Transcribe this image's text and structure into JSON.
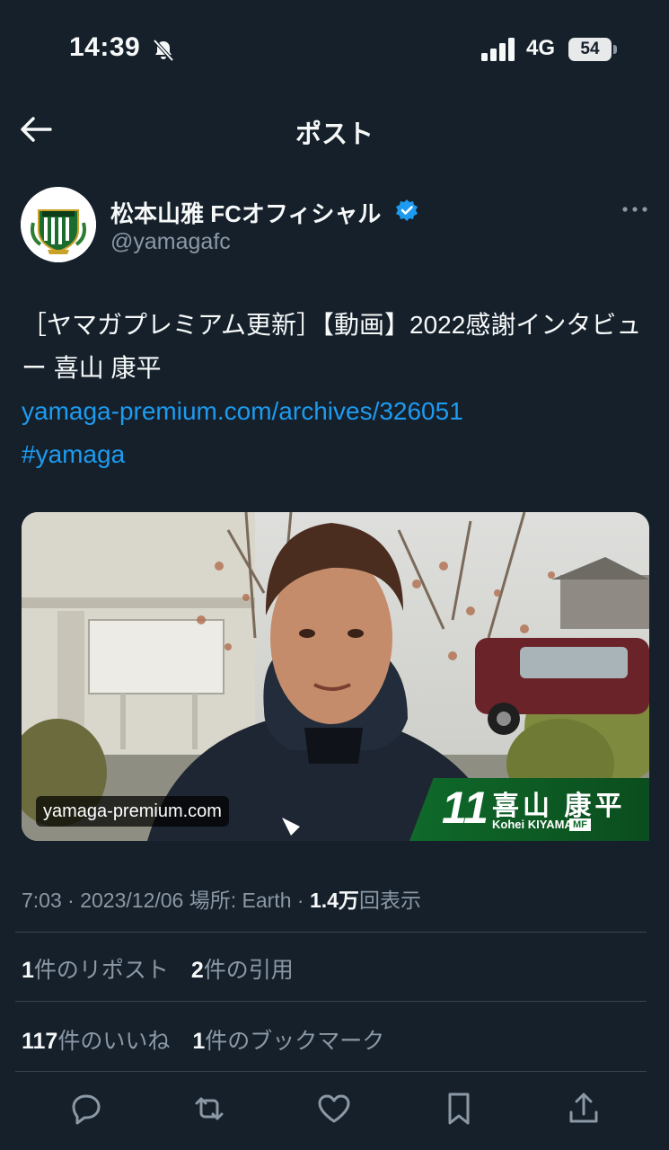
{
  "status_bar": {
    "time": "14:39",
    "network": "4G",
    "battery": "54"
  },
  "nav": {
    "title": "ポスト"
  },
  "author": {
    "display_name": "松本山雅 FCオフィシャル",
    "handle": "@yamagafc"
  },
  "tweet": {
    "text": "［ヤマガプレミアム更新］【動画】2022感謝インタビュー 喜山 康平",
    "link": "yamaga-premium.com/archives/326051",
    "hashtag": "#yamaga"
  },
  "media": {
    "domain_label": "yamaga-premium.com",
    "plate_number": "11",
    "plate_name": "喜山 康平",
    "plate_roman": "Kohei KIYAMA",
    "plate_position": "MF"
  },
  "meta": {
    "time": "7:03",
    "date": "2023/12/06",
    "location": "場所: Earth",
    "views_count": "1.4万",
    "views_label": "回表示"
  },
  "stats": {
    "reposts_count": "1",
    "reposts_label": "件のリポスト",
    "quotes_count": "2",
    "quotes_label": "件の引用",
    "likes_count": "117",
    "likes_label": "件のいいね",
    "bookmarks_count": "1",
    "bookmarks_label": "件のブックマーク"
  },
  "colors": {
    "background": "#15202b",
    "link": "#1d9bf0",
    "muted": "#8b98a5",
    "club_green": "#0f6a2a"
  },
  "icons": [
    "bell-slash-icon",
    "signal-icon",
    "back-arrow-icon",
    "verified-icon",
    "more-icon",
    "reply-icon",
    "repost-icon",
    "like-icon",
    "bookmark-icon",
    "share-icon"
  ]
}
